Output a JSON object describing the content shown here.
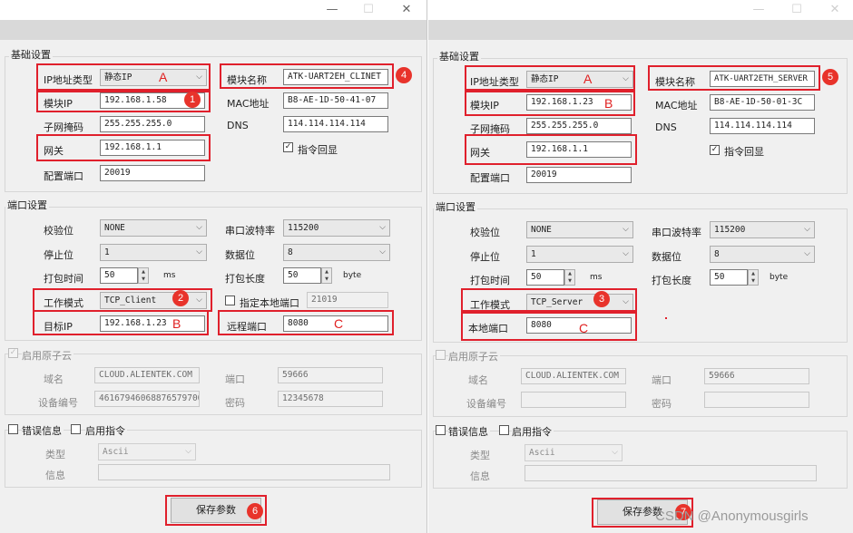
{
  "window": {
    "min": "—",
    "max": "☐",
    "close": "✕"
  },
  "left": {
    "basic_section": "基础设置",
    "ip_type_label": "IP地址类型",
    "ip_type_value": "静态IP",
    "module_name_label": "模块名称",
    "module_name_value": "ATK-UART2EH_CLINET",
    "module_ip_label": "模块IP",
    "module_ip_value": "192.168.1.58",
    "mac_label": "MAC地址",
    "mac_value": "B8-AE-1D-50-41-07",
    "subnet_label": "子网掩码",
    "subnet_value": "255.255.255.0",
    "dns_label": "DNS",
    "dns_value": "114.114.114.114",
    "gateway_label": "网关",
    "gateway_value": "192.168.1.1",
    "echo_label": "指令回显",
    "config_port_label": "配置端口",
    "config_port_value": "20019",
    "port_section": "端口设置",
    "parity_label": "校验位",
    "parity_value": "NONE",
    "baud_label": "串口波特率",
    "baud_value": "115200",
    "stopbits_label": "停止位",
    "stopbits_value": "1",
    "databits_label": "数据位",
    "databits_value": "8",
    "pack_time_label": "打包时间",
    "pack_time_value": "50",
    "pack_time_unit": "ms",
    "pack_len_label": "打包长度",
    "pack_len_value": "50",
    "pack_len_unit": "byte",
    "mode_label": "工作模式",
    "mode_value": "TCP_Client",
    "local_port_check_label": "指定本地端口",
    "local_port_value": "21019",
    "target_ip_label": "目标IP",
    "target_ip_value": "192.168.1.23",
    "remote_port_label": "远程端口",
    "remote_port_value": "8080",
    "cloud_label": "启用原子云",
    "domain_label": "域名",
    "domain_value": "CLOUD.ALIENTEK.COM",
    "cloud_port_label": "端口",
    "cloud_port_value": "59666",
    "device_id_label": "设备编号",
    "device_id_value": "46167946068876579700",
    "password_label": "密码",
    "password_value": "12345678",
    "err_info_label": "错误信息",
    "cmd_enable_label": "启用指令",
    "type_label": "类型",
    "type_value": "Ascii",
    "info_label": "信息",
    "save_button": "保存参数",
    "ann": {
      "a": "A",
      "b": "B",
      "c": "C",
      "n1": "1",
      "n2": "2",
      "n4": "4",
      "n6": "6"
    }
  },
  "right": {
    "basic_section": "基础设置",
    "ip_type_label": "IP地址类型",
    "ip_type_value": "静态IP",
    "module_name_label": "模块名称",
    "module_name_value": "ATK-UART2ETH_SERVER",
    "module_ip_label": "模块IP",
    "module_ip_value": "192.168.1.23",
    "mac_label": "MAC地址",
    "mac_value": "B8-AE-1D-50-01-3C",
    "subnet_label": "子网掩码",
    "subnet_value": "255.255.255.0",
    "dns_label": "DNS",
    "dns_value": "114.114.114.114",
    "gateway_label": "网关",
    "gateway_value": "192.168.1.1",
    "echo_label": "指令回显",
    "config_port_label": "配置端口",
    "config_port_value": "20019",
    "port_section": "端口设置",
    "parity_label": "校验位",
    "parity_value": "NONE",
    "baud_label": "串口波特率",
    "baud_value": "115200",
    "stopbits_label": "停止位",
    "stopbits_value": "1",
    "databits_label": "数据位",
    "databits_value": "8",
    "pack_time_label": "打包时间",
    "pack_time_value": "50",
    "pack_time_unit": "ms",
    "pack_len_label": "打包长度",
    "pack_len_value": "50",
    "pack_len_unit": "byte",
    "mode_label": "工作模式",
    "mode_value": "TCP_Server",
    "local_port_label": "本地端口",
    "local_port_value": "8080",
    "cloud_label": "启用原子云",
    "domain_label": "域名",
    "domain_value": "CLOUD.ALIENTEK.COM",
    "cloud_port_label": "端口",
    "cloud_port_value": "59666",
    "device_id_label": "设备编号",
    "password_label": "密码",
    "err_info_label": "错误信息",
    "cmd_enable_label": "启用指令",
    "type_label": "类型",
    "type_value": "Ascii",
    "info_label": "信息",
    "save_button": "保存参数",
    "ann": {
      "a": "A",
      "b": "B",
      "c": "C",
      "n3": "3",
      "n5": "5",
      "n7": "7"
    }
  },
  "watermark": "CSDN @Anonymousgirls"
}
